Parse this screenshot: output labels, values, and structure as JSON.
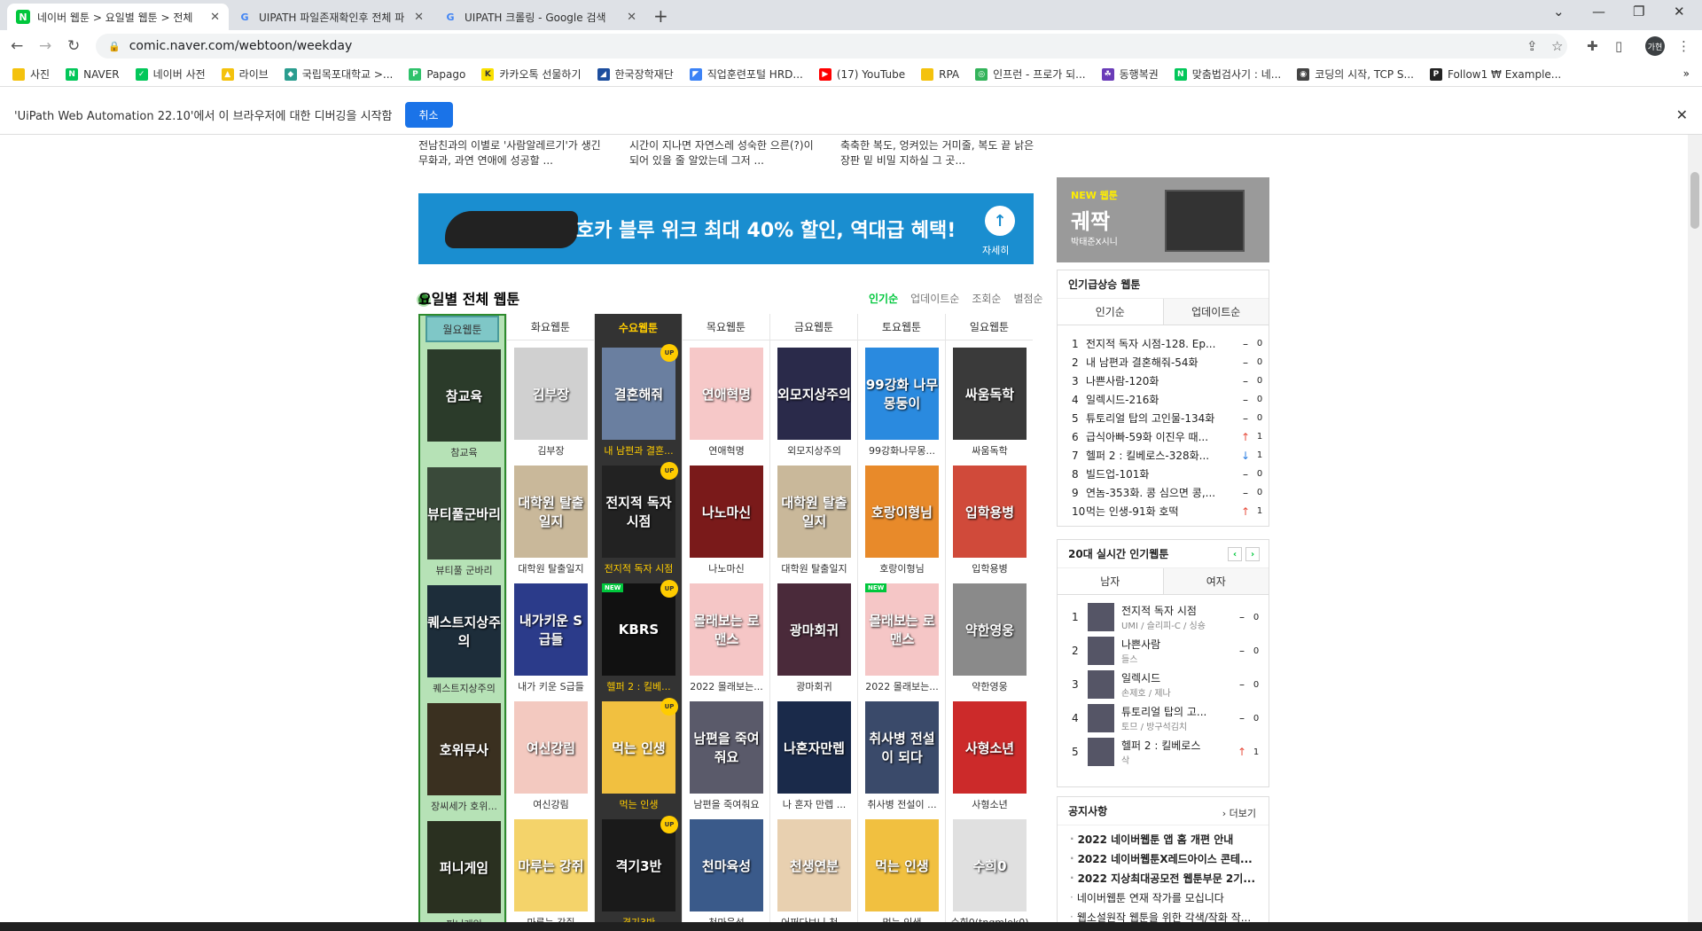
{
  "browser": {
    "tabs": [
      {
        "title": "네이버 웹툰 > 요일별 웹툰 > 전체",
        "active": true
      },
      {
        "title": "UIPATH 파일존재확인후 전체 파",
        "active": false
      },
      {
        "title": "UIPATH 크롤링 - Google 검색",
        "active": false
      }
    ],
    "url": "comic.naver.com/webtoon/weekday",
    "profile": "가현",
    "bookmarks": [
      "사진",
      "NAVER",
      "네이버 사전",
      "라이브",
      "국립목포대학교 >...",
      "Papago",
      "카카오톡 선물하기",
      "한국장학재단",
      "직업훈련포털 HRD...",
      "(17) YouTube",
      "RPA",
      "인프런 - 프로가 되...",
      "동행복권",
      "맞춤법검사기 : 네...",
      "코딩의 시작, TCP S...",
      "Follow1 ₩ Example..."
    ]
  },
  "infobar": {
    "message": "'UiPath Web Automation 22.10'에서 이 브라우저에 대한 디버깅을 시작함",
    "cancel": "취소"
  },
  "descriptions": [
    "전남친과의 이별로 '사람알레르기'가 생긴 무화과, 과연 연애에 성공할 ...",
    "시간이 지나면 자연스레 성숙한 으른(?)이 되어 있을 줄 알았는데 그저 ...",
    "축축한 복도, 엉켜있는 거미줄, 복도 끝 낡은 장판 밑 비밀 지하실 그 곳..."
  ],
  "banner": {
    "text": "호카 블루 위크 최대 40% 할인, 역대급 혜택!",
    "more": "자세히"
  },
  "section": {
    "title": "요일별 전체 웹툰",
    "sorts": [
      "인기순",
      "업데이트순",
      "조회순",
      "별점순"
    ]
  },
  "days": [
    {
      "label": "월요웹툰",
      "items": [
        "참교육",
        "뷰티풀 군바리",
        "퀘스트지상주의",
        "장씨세가 호위...",
        "퍼니게임"
      ]
    },
    {
      "label": "화요웹툰",
      "items": [
        "김부장",
        "대학원 탈출일지",
        "내가 키운 S급들",
        "여신강림",
        "마루는 강쥐"
      ]
    },
    {
      "label": "수요웹툰",
      "items": [
        "내 남편과 결혼...",
        "전지적 독자 시점",
        "헬퍼 2 : 킬베...",
        "먹는 인생",
        "격기3반"
      ]
    },
    {
      "label": "목요웹툰",
      "items": [
        "연애혁명",
        "나노마신",
        "2022 몰래보는...",
        "남편을 죽여줘요",
        "천마육성"
      ]
    },
    {
      "label": "금요웹툰",
      "items": [
        "외모지상주의",
        "대학원 탈출일지",
        "광마회귀",
        "나 혼자 만렙 ...",
        "어쩌다보니 천..."
      ]
    },
    {
      "label": "토요웹툰",
      "items": [
        "99강화나무몽...",
        "호랑이형님",
        "2022 몰래보는...",
        "취사병 전설이 ...",
        "먹는 인생"
      ]
    },
    {
      "label": "일요웹툰",
      "items": [
        "싸움독학",
        "입학용병",
        "약한영웅",
        "사형소년",
        "수희0(tngmlek0)"
      ]
    }
  ],
  "thumb_text": [
    [
      "참교육",
      "뷰티풀군바리",
      "퀘스트지상주의",
      "호위무사",
      "퍼니게임"
    ],
    [
      "김부장",
      "대학원 탈출일지",
      "내가키운 S급들",
      "여신강림",
      "마루는 강쥐"
    ],
    [
      "결혼해줘",
      "전지적 독자 시점",
      "KBRS",
      "먹는 인생",
      "격기3반"
    ],
    [
      "연애혁명",
      "나노마신",
      "몰래보는 로맨스",
      "남편을 죽여줘요",
      "천마육성"
    ],
    [
      "외모지상주의",
      "대학원 탈출일지",
      "광마회귀",
      "나혼자만렙",
      "천생연분"
    ],
    [
      "99강화 나무몽둥이",
      "호랑이형님",
      "몰래보는 로맨스",
      "취사병 전설이 되다",
      "먹는 인생"
    ],
    [
      "싸움독학",
      "입학용병",
      "약한영웅",
      "사형소년",
      "수희0"
    ]
  ],
  "badges": {
    "up": "UP",
    "new": "NEW"
  },
  "new_webtoon": {
    "label": "NEW 웹툰",
    "title": "궤짝",
    "author": "박태준X시니"
  },
  "rising": {
    "title": "인기급상승 웹툰",
    "tabs": [
      "인기순",
      "업데이트순"
    ],
    "rows": [
      {
        "n": "1",
        "t": "전지적 독자 시점-128. Ep...",
        "chg": "–",
        "v": "0",
        "dir": "same"
      },
      {
        "n": "2",
        "t": "내 남편과 결혼해줘-54화",
        "chg": "–",
        "v": "0",
        "dir": "same"
      },
      {
        "n": "3",
        "t": "나쁜사람-120화",
        "chg": "–",
        "v": "0",
        "dir": "same"
      },
      {
        "n": "4",
        "t": "일렉시드-216화",
        "chg": "–",
        "v": "0",
        "dir": "same"
      },
      {
        "n": "5",
        "t": "튜토리얼 탑의 고인물-134화",
        "chg": "–",
        "v": "0",
        "dir": "same"
      },
      {
        "n": "6",
        "t": "급식아빠-59화 이진우 때...",
        "chg": "↑",
        "v": "1",
        "dir": "up"
      },
      {
        "n": "7",
        "t": "헬퍼 2 : 킬베로스-328화...",
        "chg": "↓",
        "v": "1",
        "dir": "down"
      },
      {
        "n": "8",
        "t": "빌드업-101화",
        "chg": "–",
        "v": "0",
        "dir": "same"
      },
      {
        "n": "9",
        "t": "연놈-353화. 콩 심으면 콩,...",
        "chg": "–",
        "v": "0",
        "dir": "same"
      },
      {
        "n": "10",
        "t": "먹는 인생-91화 호떡",
        "chg": "↑",
        "v": "1",
        "dir": "up"
      }
    ]
  },
  "realtime": {
    "title": "20대 실시간 인기웹툰",
    "tabs": [
      "남자",
      "여자"
    ],
    "rows": [
      {
        "n": "1",
        "t": "전지적 독자 시점",
        "a": "UMI / 슬리피-C / 싱숑",
        "chg": "–",
        "v": "0"
      },
      {
        "n": "2",
        "t": "나쁜사람",
        "a": "들스",
        "chg": "–",
        "v": "0"
      },
      {
        "n": "3",
        "t": "일렉시드",
        "a": "손제호 / 제나",
        "chg": "–",
        "v": "0"
      },
      {
        "n": "4",
        "t": "튜토리얼 탑의 고...",
        "a": "토므 / 방구석김치",
        "chg": "–",
        "v": "0"
      },
      {
        "n": "5",
        "t": "헬퍼 2 : 킬베로스",
        "a": "삭",
        "chg": "↑",
        "v": "1"
      }
    ]
  },
  "notices": {
    "title": "공지사항",
    "more": "더보기",
    "items": [
      "2022 네이버웹툰 앱 홈 개편 안내",
      "2022 네이버웹툰X레드아이스 콘테...",
      "2022 지상최대공모전 웹툰부문 2기...",
      "네이버웹툰 연재 작가를 모십니다",
      "웹소설원작 웹툰을 위한 각색/작화 작..."
    ]
  },
  "colors": {
    "naver_green": "#00c73c",
    "wed_bg": "#333333",
    "wed_fg": "#ffcc00",
    "mon_highlight": "#b6e2b6",
    "banner_blue": "#1a8ed0"
  }
}
